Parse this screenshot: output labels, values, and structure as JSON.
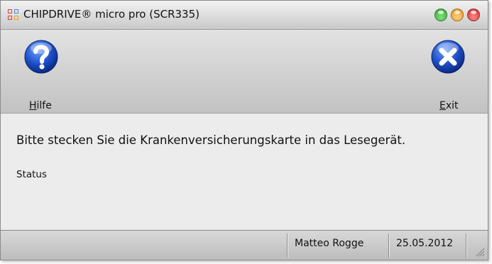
{
  "window": {
    "title": "CHIPDRIVE® micro pro (SCR335)",
    "app_icon": "app-grid-icon",
    "controls": [
      "minimize",
      "maximize",
      "close"
    ]
  },
  "toolbar": {
    "help": {
      "label_access_key": "H",
      "label_rest": "ilfe",
      "icon": "question-icon"
    },
    "exit": {
      "label_access_key": "E",
      "label_rest": "xit",
      "icon": "close-x-icon"
    }
  },
  "content": {
    "message": "Bitte stecken Sie die Krankenversicherungskarte in das Lesegerät.",
    "status": "Status"
  },
  "statusbar": {
    "user": "Matteo Rogge",
    "date": "25.05.2012"
  },
  "colors": {
    "button_green": "#3fbf3f",
    "button_orange": "#f0a020",
    "button_red": "#e03030",
    "icon_blue": "#1d4fc9"
  }
}
